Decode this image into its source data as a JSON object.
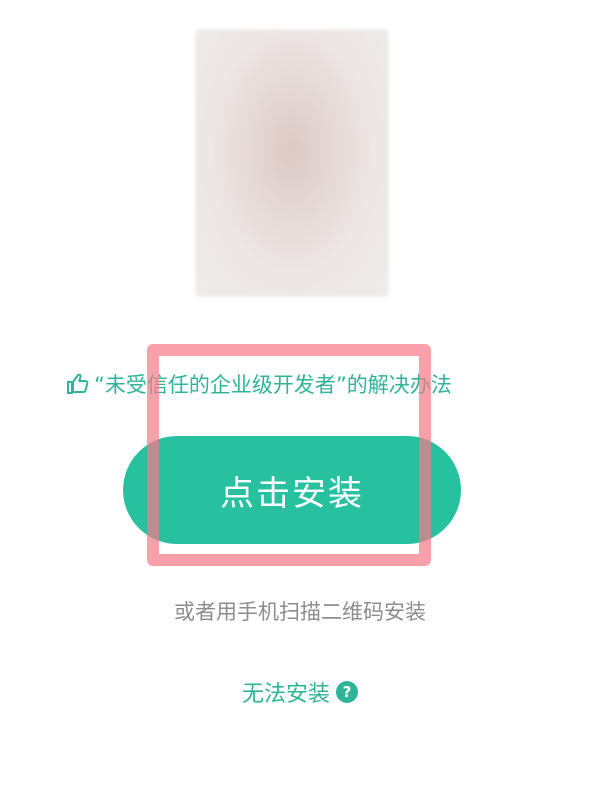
{
  "app_icon": {
    "icon": "app-icon-placeholder"
  },
  "trust_link": {
    "label": "“未受信任的企业级开发者”的解决办法",
    "icon": "thumbs-up-icon",
    "color": "#2fb49a"
  },
  "install_button": {
    "label": "点击安装",
    "color": "#27c1a0"
  },
  "highlight": {
    "color": "#f67887"
  },
  "qr_hint": {
    "label": "或者用手机扫描二维码安装"
  },
  "cannot_install": {
    "label": "无法安装",
    "help_glyph": "?",
    "icon": "help-icon"
  }
}
